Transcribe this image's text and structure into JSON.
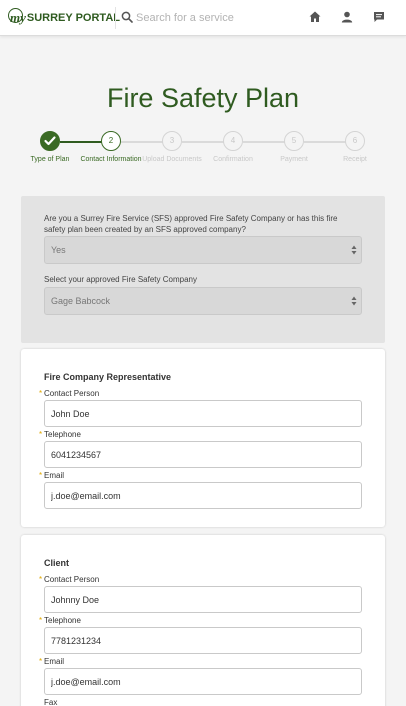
{
  "header": {
    "logo_my": "my",
    "logo_text": "SURREY PORTAL",
    "search_placeholder": "Search for a service",
    "search_value": ""
  },
  "page": {
    "title": "Fire Safety Plan"
  },
  "stepper": {
    "steps": [
      {
        "number": "✓",
        "label": "Type of Plan",
        "status": "complete"
      },
      {
        "number": "2",
        "label": "Contact Information",
        "status": "current"
      },
      {
        "number": "3",
        "label": "Upload Documents",
        "status": "upcoming"
      },
      {
        "number": "4",
        "label": "Confirmation",
        "status": "upcoming"
      },
      {
        "number": "5",
        "label": "Payment",
        "status": "upcoming"
      },
      {
        "number": "6",
        "label": "Receipt",
        "status": "upcoming"
      }
    ]
  },
  "approval": {
    "question": "Are you a Surrey Fire Service (SFS) approved Fire Safety Company or has this fire safety plan been created by an SFS approved company?",
    "answer": "Yes",
    "company_label": "Select your approved Fire Safety Company",
    "company_value": "Gage Babcock"
  },
  "fire_company_rep": {
    "heading": "Fire Company Representative",
    "contact_label": "Contact Person",
    "contact_value": "John Doe",
    "telephone_label": "Telephone",
    "telephone_value": "6041234567",
    "email_label": "Email",
    "email_value": "j.doe@email.com"
  },
  "client": {
    "heading": "Client",
    "contact_label": "Contact Person",
    "contact_value": "Johnny Doe",
    "telephone_label": "Telephone",
    "telephone_value": "7781231234",
    "email_label": "Email",
    "email_value": "j.doe@email.com",
    "fax_label": "Fax"
  },
  "required_marker": "*",
  "colors": {
    "brand_green": "#2f5b20",
    "step_green": "#3a6a24",
    "required_star": "#e0a800",
    "page_bg": "#f4f4f4"
  },
  "icons": {
    "search": "search-icon",
    "home": "home-icon",
    "user": "user-icon",
    "messages": "message-icon",
    "checkmark": "check-icon",
    "select_arrows": "select-arrows-icon"
  }
}
